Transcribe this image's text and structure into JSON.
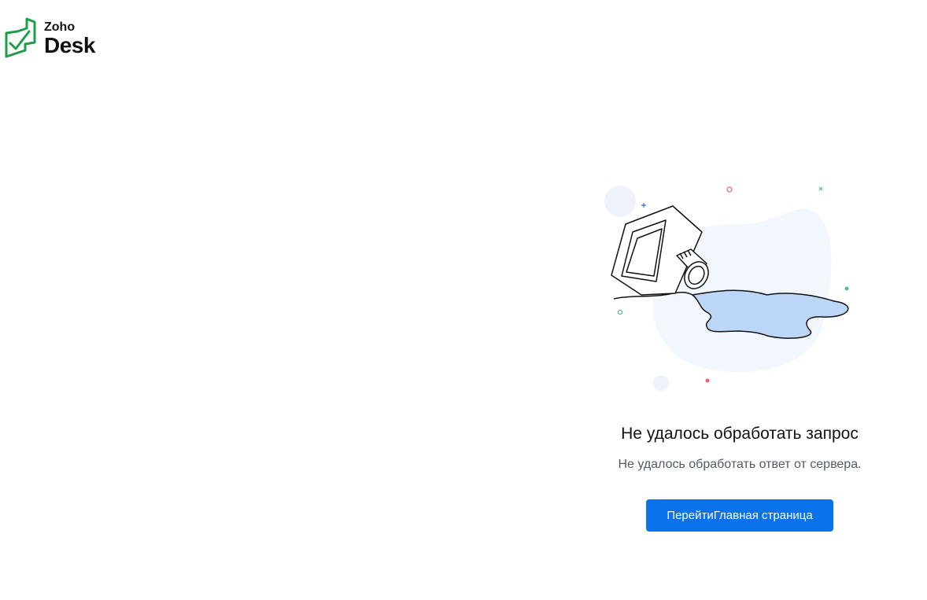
{
  "brand": {
    "sub": "Zoho",
    "main": "Desk",
    "color": "#1d9e47"
  },
  "error": {
    "title": "Не удалось обработать запрос",
    "description": "Не удалось обработать ответ от сервера."
  },
  "actions": {
    "home_button": "ПерейтиГлавная страница"
  },
  "colors": {
    "button": "#0a73eb",
    "spill": "#bcd6f7",
    "blob": "#f2f6fd"
  },
  "icons": {
    "logo": "zoho-desk-logo",
    "illustration": "spilled-ink-bottle"
  }
}
